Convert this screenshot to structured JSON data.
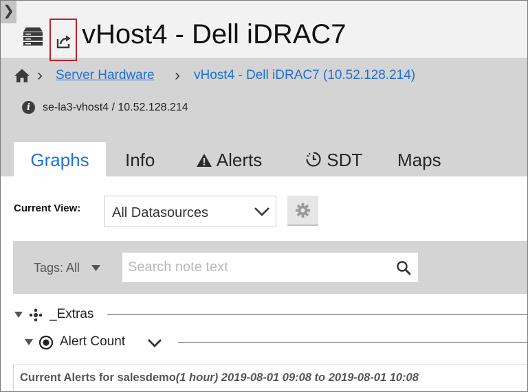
{
  "window": {
    "collapse_glyph": "❯"
  },
  "title": {
    "text": "vHost4 - Dell iDRAC7",
    "icon": "server-icon",
    "share_icon": "share-icon"
  },
  "breadcrumb": {
    "home_icon": "home-icon",
    "separator": "›",
    "items": [
      {
        "label": "Server Hardware"
      },
      {
        "label": "vHost4 - Dell iDRAC7 (10.52.128.214)"
      }
    ]
  },
  "host_info": {
    "icon": "info-icon",
    "glyph": "i",
    "text": "se-la3-vhost4 / 10.52.128.214"
  },
  "tabs": [
    {
      "label": "Graphs",
      "active": true
    },
    {
      "label": "Info"
    },
    {
      "label": "Alerts",
      "icon": "warning-icon"
    },
    {
      "label": "SDT",
      "icon": "clock-icon"
    },
    {
      "label": "Maps"
    }
  ],
  "current_view": {
    "label": "Current View:",
    "selected": "All Datasources",
    "settings_icon": "gear-icon"
  },
  "tag_filter": {
    "label": "Tags: All",
    "search_placeholder": "Search note text"
  },
  "tree": {
    "group": {
      "label": "_Extras"
    },
    "item": {
      "label": "Alert Count"
    }
  },
  "graph": {
    "title_prefix": "Current Alerts for salesdemo",
    "range": "(1 hour) 2019-08-01 09:08 to 2019-08-01 10:08"
  },
  "colors": {
    "accent": "#1e73d8",
    "header_bg": "#d4d4d4",
    "title_bg": "#f2f2f2",
    "highlight_border": "#b3232a"
  }
}
